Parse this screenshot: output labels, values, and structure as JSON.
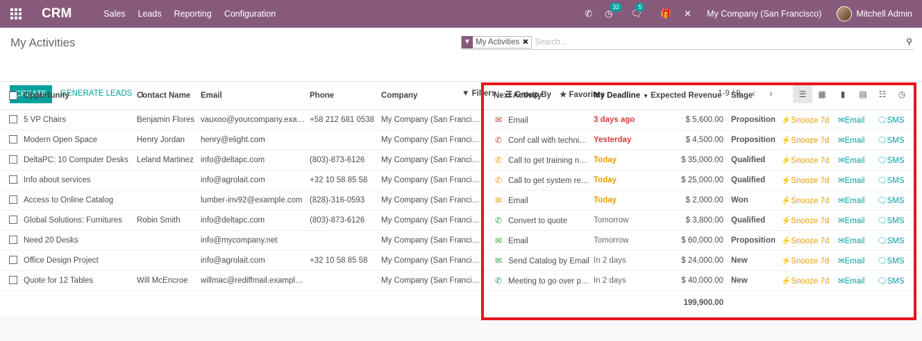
{
  "topbar": {
    "app_name": "CRM",
    "menu": [
      "Sales",
      "Leads",
      "Reporting",
      "Configuration"
    ],
    "activity_count": "32",
    "message_count": "5",
    "company": "My Company (San Francisco)",
    "user": "Mitchell Admin"
  },
  "control_panel": {
    "breadcrumb": "My Activities",
    "facet_label": "My Activities",
    "search_placeholder": "Search...",
    "create_label": "CREATE",
    "generate_label": "GENERATE LEADS",
    "filters_label": "Filters",
    "group_by_label": "Group By",
    "favorites_label": "Favorites",
    "pager": "1-9 / 9"
  },
  "table": {
    "headers": {
      "opportunity": "Opportunity",
      "contact": "Contact Name",
      "email": "Email",
      "phone": "Phone",
      "company": "Company",
      "next_activity": "Next Activity",
      "deadline": "My Deadline",
      "revenue": "Expected Revenue",
      "stage": "Stage"
    },
    "action_labels": {
      "snooze": "Snooze 7d",
      "email": "Email",
      "sms": "SMS"
    },
    "rows": [
      {
        "opportunity": "5 VP Chairs",
        "contact": "Benjamin Flores",
        "email": "vauxoo@yourcompany.example.com",
        "phone": "+58 212 681 0538",
        "company": "My Company (San Francisco)",
        "activity": "Email",
        "activity_icon": "envelope-icon",
        "icon_color": "#d23f3a",
        "deadline": "3 days ago",
        "deadline_state": "overdue",
        "revenue": "$ 5,600.00",
        "stage": "Proposition"
      },
      {
        "opportunity": "Modern Open Space",
        "contact": "Henry Jordan",
        "email": "henry@elight.com",
        "phone": "",
        "company": "My Company (San Francisco)",
        "activity": "Conf call with technical service",
        "activity_icon": "phone-icon",
        "icon_color": "#d23f3a",
        "deadline": "Yesterday",
        "deadline_state": "overdue",
        "revenue": "$ 4,500.00",
        "stage": "Proposition"
      },
      {
        "opportunity": "DeltaPC: 10 Computer Desks",
        "contact": "Leland Martinez",
        "email": "info@deltapc.com",
        "phone": "(803)-873-6126",
        "company": "My Company (San Francisco)",
        "activity": "Call to get training needs",
        "activity_icon": "phone-icon",
        "icon_color": "#e99d00",
        "deadline": "Today",
        "deadline_state": "today",
        "revenue": "$ 35,000.00",
        "stage": "Qualified"
      },
      {
        "opportunity": "Info about services",
        "contact": "",
        "email": "info@agrolait.com",
        "phone": "+32 10 58 85 58",
        "company": "My Company (San Francisco)",
        "activity": "Call to get system requirements",
        "activity_icon": "phone-icon",
        "icon_color": "#e99d00",
        "deadline": "Today",
        "deadline_state": "today",
        "revenue": "$ 25,000.00",
        "stage": "Qualified"
      },
      {
        "opportunity": "Access to Online Catalog",
        "contact": "",
        "email": "lumber-inv92@example.com",
        "phone": "(828)-316-0593",
        "company": "My Company (San Francisco)",
        "activity": "Email",
        "activity_icon": "envelope-icon",
        "icon_color": "#e99d00",
        "deadline": "Today",
        "deadline_state": "today",
        "revenue": "$ 2,000.00",
        "stage": "Won"
      },
      {
        "opportunity": "Global Solutions: Furnitures",
        "contact": "Robin Smith",
        "email": "info@deltapc.com",
        "phone": "(803)-873-6126",
        "company": "My Company (San Francisco)",
        "activity": "Convert to quote",
        "activity_icon": "phone-icon",
        "icon_color": "#28a745",
        "deadline": "Tomorrow",
        "deadline_state": "planned",
        "revenue": "$ 3,800.00",
        "stage": "Qualified"
      },
      {
        "opportunity": "Need 20 Desks",
        "contact": "",
        "email": "info@mycompany.net",
        "phone": "",
        "company": "My Company (San Francisco)",
        "activity": "Email",
        "activity_icon": "envelope-icon",
        "icon_color": "#28a745",
        "deadline": "Tomorrow",
        "deadline_state": "planned",
        "revenue": "$ 60,000.00",
        "stage": "Proposition"
      },
      {
        "opportunity": "Office Design Project",
        "contact": "",
        "email": "info@agrolait.com",
        "phone": "+32 10 58 85 58",
        "company": "My Company (San Francisco)",
        "activity": "Send Catalog by Email",
        "activity_icon": "envelope-icon",
        "icon_color": "#28a745",
        "deadline": "In 2 days",
        "deadline_state": "planned",
        "revenue": "$ 24,000.00",
        "stage": "New"
      },
      {
        "opportunity": "Quote for 12 Tables",
        "contact": "Will McEncroe",
        "email": "willmac@rediffmail.example.com",
        "phone": "",
        "company": "My Company (San Francisco)",
        "activity": "Meeting to go over pricing",
        "activity_icon": "phone-icon",
        "icon_color": "#28a745",
        "deadline": "In 2 days",
        "deadline_state": "planned",
        "revenue": "$ 40,000.00",
        "stage": "New"
      }
    ],
    "total_revenue": "199,900.00"
  },
  "colors": {
    "brand": "#875a7b",
    "accent": "#00a09d",
    "highlight": "#e8141a"
  }
}
